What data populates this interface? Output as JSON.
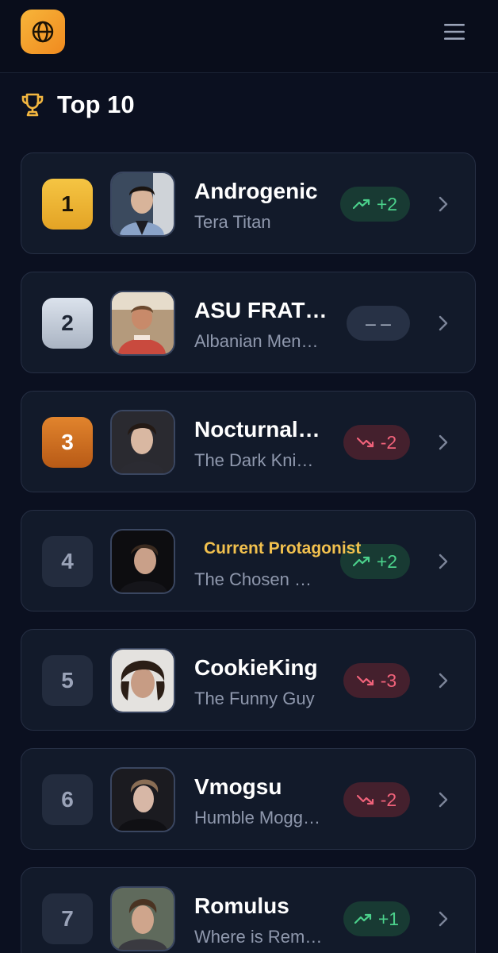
{
  "header": {
    "logo_icon": "globe-icon",
    "menu_icon": "hamburger-menu-icon",
    "accent_color": "#f5a72e"
  },
  "section": {
    "icon": "trophy-icon",
    "title": "Top 10"
  },
  "leaderboard": [
    {
      "rank": "1",
      "name": "Androgenic",
      "subtitle": "Tera Titan",
      "change": "+2",
      "trend": "up",
      "medal": "gold"
    },
    {
      "rank": "2",
      "name": "ASU FRAT…",
      "subtitle": "Albanian Men…",
      "change": "– –",
      "trend": "same",
      "medal": "silver"
    },
    {
      "rank": "3",
      "name": "Nocturnal…",
      "subtitle": "The Dark Kni…",
      "change": "-2",
      "trend": "down",
      "medal": "bronze"
    },
    {
      "rank": "4",
      "name": "",
      "badge": "Current Protagonist",
      "subtitle": "The Chosen …",
      "change": "+2",
      "trend": "up",
      "medal": "none"
    },
    {
      "rank": "5",
      "name": "CookieKing",
      "subtitle": "The Funny Guy",
      "change": "-3",
      "trend": "down",
      "medal": "none"
    },
    {
      "rank": "6",
      "name": "Vmogsu",
      "subtitle": "Humble Mogg…",
      "change": "-2",
      "trend": "down",
      "medal": "none"
    },
    {
      "rank": "7",
      "name": "Romulus",
      "subtitle": "Where is Rem…",
      "change": "+1",
      "trend": "up",
      "medal": "none"
    }
  ],
  "colors": {
    "up": "#4bd18b",
    "down": "#f0627a",
    "gold": "#f5c543",
    "silver": "#c3ccd9",
    "bronze": "#d0711f",
    "protagonist": "#f2c14e"
  }
}
